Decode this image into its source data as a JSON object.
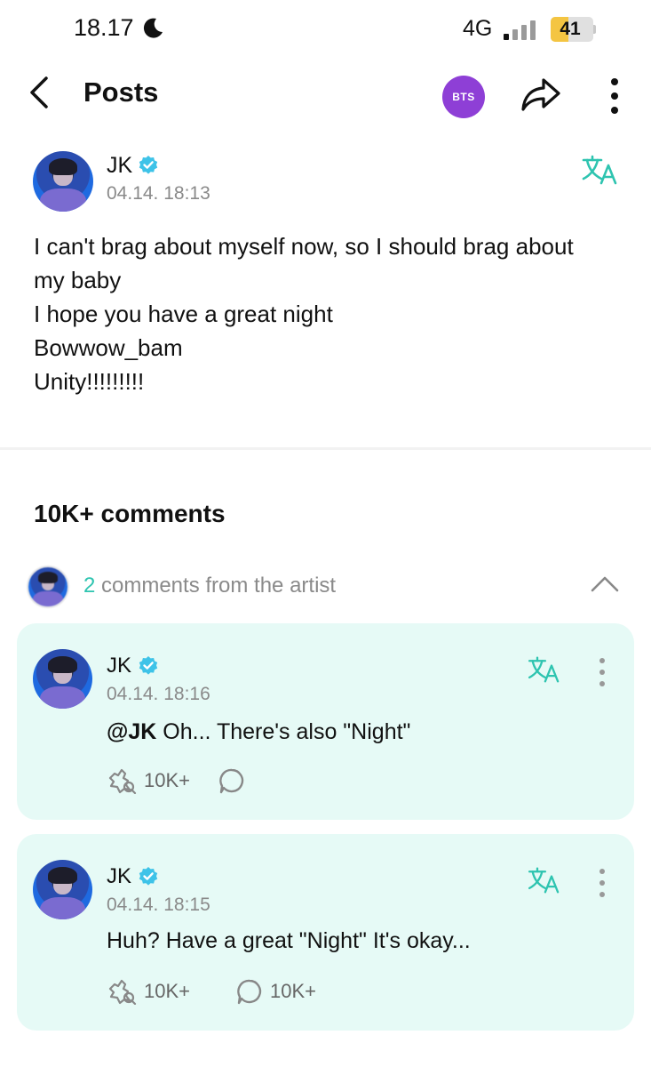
{
  "status_bar": {
    "time": "18.17",
    "network": "4G",
    "battery": "41",
    "battery_level": 0.41
  },
  "header": {
    "title": "Posts",
    "badge": "BTS"
  },
  "post": {
    "author": "JK",
    "timestamp": "04.14. 18:13",
    "lines": [
      "I can't brag about myself now, so I should brag about",
      "my baby",
      "I hope you have a great night",
      "Bowwow_bam",
      "Unity!!!!!!!!!"
    ]
  },
  "comments_section": {
    "count_label": "10K+ comments",
    "artist_comments_count": "2",
    "artist_comments_label": "comments from the artist"
  },
  "comments": [
    {
      "author": "JK",
      "timestamp": "04.14. 18:16",
      "mention": "@JK",
      "text": " Oh... There's also \"Night\"",
      "likes": "10K+",
      "replies": ""
    },
    {
      "author": "JK",
      "timestamp": "04.14. 18:15",
      "mention": "",
      "text": "Huh? Have a great \"Night\" It's okay...",
      "likes": "10K+",
      "replies": "10K+"
    }
  ],
  "colors": {
    "accent": "#2ec4b0",
    "badge_purple": "#8e3fd6",
    "card_bg": "#e6faf6",
    "verified_blue": "#3ec3e8"
  }
}
